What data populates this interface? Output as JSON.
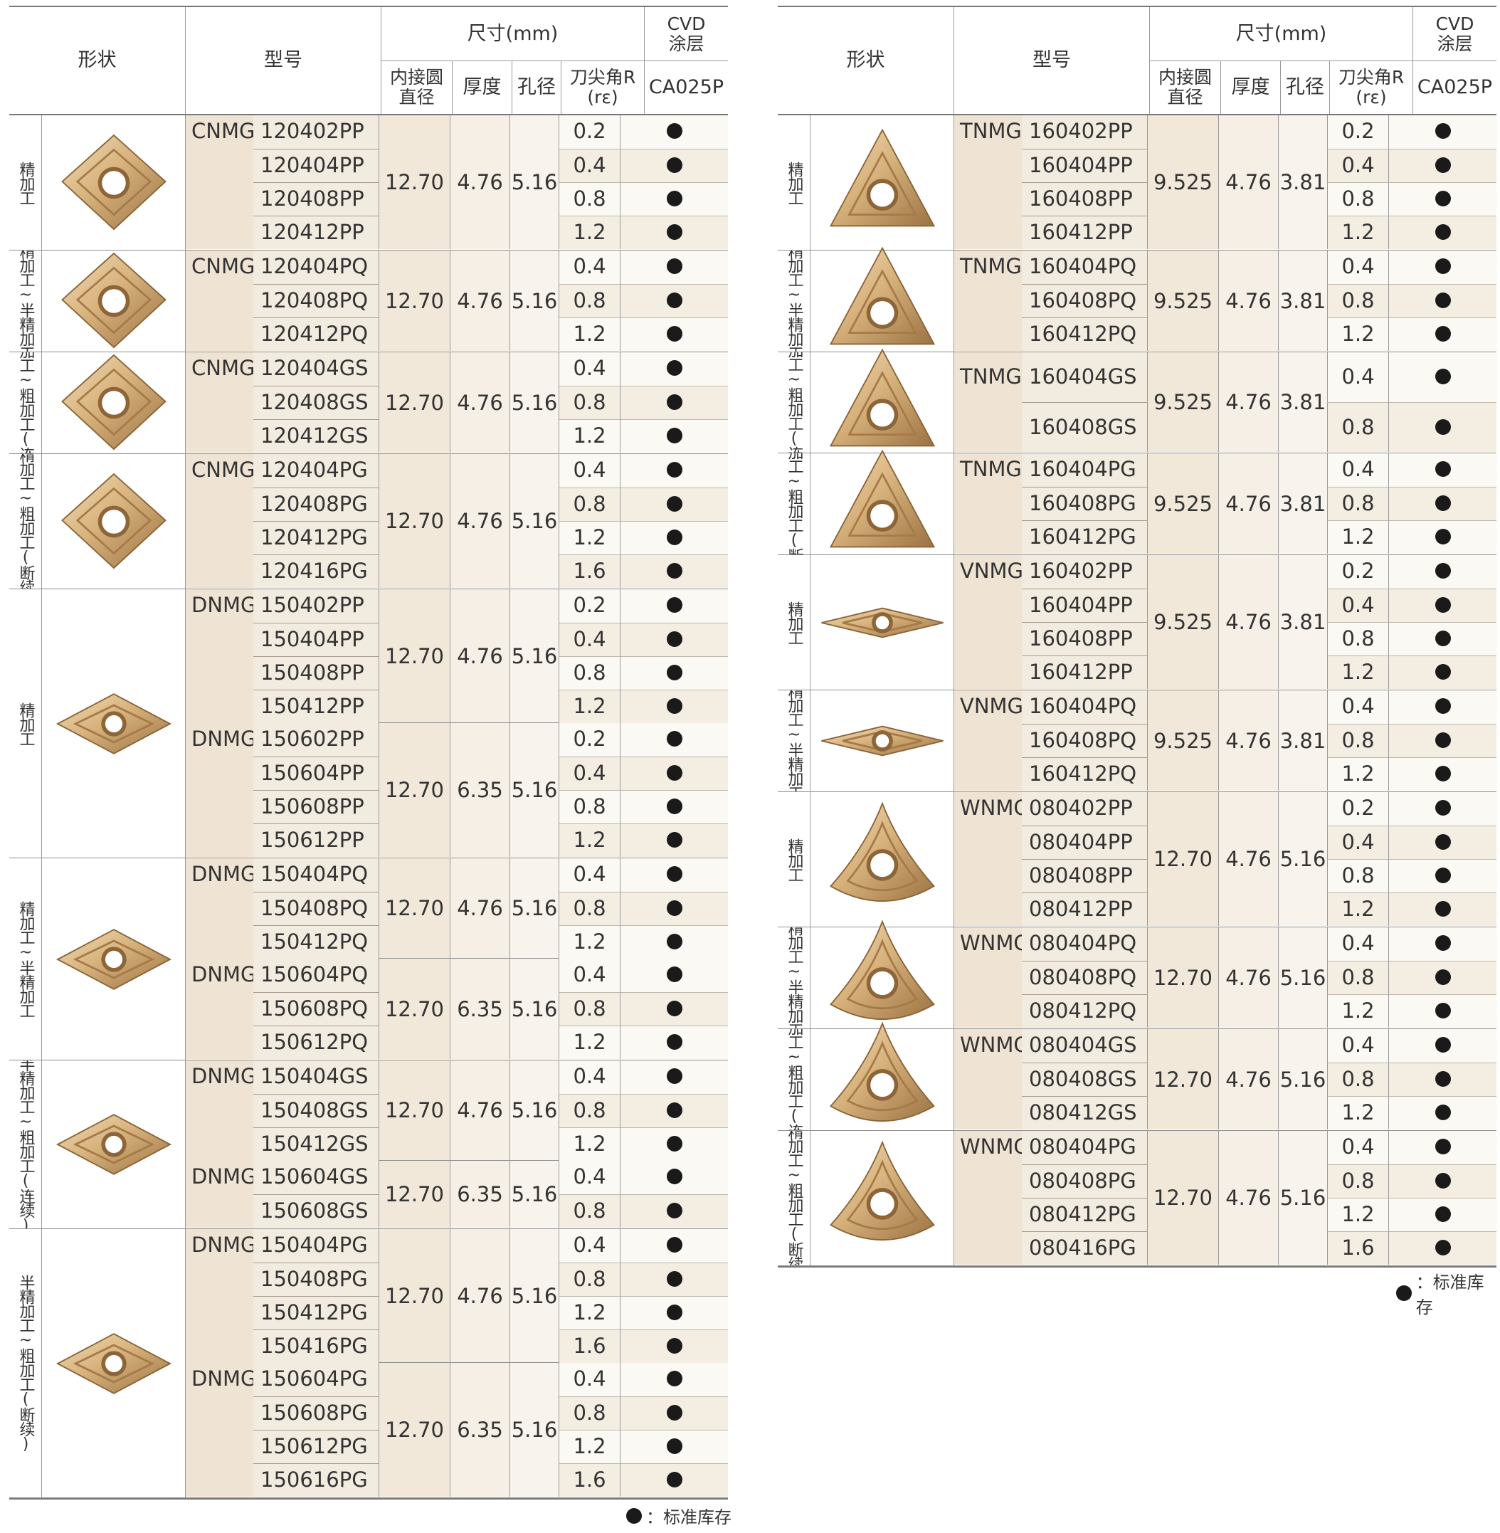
{
  "header": {
    "shape": "形状",
    "model": "型号",
    "dims": "尺寸(mm)",
    "cvd": "CVD\n涂层",
    "ic": "内接圆\n直径",
    "thick": "厚度",
    "hole": "孔径",
    "radius": "刀尖角R\n(rε)",
    "grade": "CA025P"
  },
  "legend": {
    "label": "：标准库存"
  },
  "left_groups": [
    {
      "label": "精加工",
      "shape": "C",
      "series": [
        {
          "prefix": "CNMG",
          "ic": "12.70",
          "t": "4.76",
          "h": "5.16",
          "rows": [
            {
              "code": "120402PP",
              "r": "0.2"
            },
            {
              "code": "120404PP",
              "r": "0.4"
            },
            {
              "code": "120408PP",
              "r": "0.8"
            },
            {
              "code": "120412PP",
              "r": "1.2"
            }
          ]
        }
      ]
    },
    {
      "label": "精加工~半精加工",
      "shape": "C",
      "series": [
        {
          "prefix": "CNMG",
          "ic": "12.70",
          "t": "4.76",
          "h": "5.16",
          "rows": [
            {
              "code": "120404PQ",
              "r": "0.4"
            },
            {
              "code": "120408PQ",
              "r": "0.8"
            },
            {
              "code": "120412PQ",
              "r": "1.2"
            }
          ]
        }
      ]
    },
    {
      "label": "半精加工~粗加工(连续)",
      "shape": "C",
      "series": [
        {
          "prefix": "CNMG",
          "ic": "12.70",
          "t": "4.76",
          "h": "5.16",
          "rows": [
            {
              "code": "120404GS",
              "r": "0.4"
            },
            {
              "code": "120408GS",
              "r": "0.8"
            },
            {
              "code": "120412GS",
              "r": "1.2"
            }
          ]
        }
      ]
    },
    {
      "label": "半精加工~粗加工(断续)",
      "shape": "C",
      "series": [
        {
          "prefix": "CNMG",
          "ic": "12.70",
          "t": "4.76",
          "h": "5.16",
          "rows": [
            {
              "code": "120404PG",
              "r": "0.4"
            },
            {
              "code": "120408PG",
              "r": "0.8"
            },
            {
              "code": "120412PG",
              "r": "1.2"
            },
            {
              "code": "120416PG",
              "r": "1.6"
            }
          ]
        }
      ]
    },
    {
      "label": "精加工",
      "shape": "D",
      "series": [
        {
          "prefix": "DNMG",
          "ic": "12.70",
          "t": "4.76",
          "h": "5.16",
          "rows": [
            {
              "code": "150402PP",
              "r": "0.2"
            },
            {
              "code": "150404PP",
              "r": "0.4"
            },
            {
              "code": "150408PP",
              "r": "0.8"
            },
            {
              "code": "150412PP",
              "r": "1.2"
            }
          ]
        },
        {
          "prefix": "DNMG",
          "ic": "12.70",
          "t": "6.35",
          "h": "5.16",
          "rows": [
            {
              "code": "150602PP",
              "r": "0.2"
            },
            {
              "code": "150604PP",
              "r": "0.4"
            },
            {
              "code": "150608PP",
              "r": "0.8"
            },
            {
              "code": "150612PP",
              "r": "1.2"
            }
          ]
        }
      ]
    },
    {
      "label": "精加工~半精加工",
      "shape": "D",
      "series": [
        {
          "prefix": "DNMG",
          "ic": "12.70",
          "t": "4.76",
          "h": "5.16",
          "rows": [
            {
              "code": "150404PQ",
              "r": "0.4"
            },
            {
              "code": "150408PQ",
              "r": "0.8"
            },
            {
              "code": "150412PQ",
              "r": "1.2"
            }
          ]
        },
        {
          "prefix": "DNMG",
          "ic": "12.70",
          "t": "6.35",
          "h": "5.16",
          "rows": [
            {
              "code": "150604PQ",
              "r": "0.4"
            },
            {
              "code": "150608PQ",
              "r": "0.8"
            },
            {
              "code": "150612PQ",
              "r": "1.2"
            }
          ]
        }
      ]
    },
    {
      "label": "半精加工~粗加工(连续)",
      "shape": "D",
      "series": [
        {
          "prefix": "DNMG",
          "ic": "12.70",
          "t": "4.76",
          "h": "5.16",
          "rows": [
            {
              "code": "150404GS",
              "r": "0.4"
            },
            {
              "code": "150408GS",
              "r": "0.8"
            },
            {
              "code": "150412GS",
              "r": "1.2"
            }
          ]
        },
        {
          "prefix": "DNMG",
          "ic": "12.70",
          "t": "6.35",
          "h": "5.16",
          "rows": [
            {
              "code": "150604GS",
              "r": "0.4"
            },
            {
              "code": "150608GS",
              "r": "0.8"
            }
          ]
        }
      ]
    },
    {
      "label": "半精加工~粗加工(断续)",
      "shape": "D",
      "series": [
        {
          "prefix": "DNMG",
          "ic": "12.70",
          "t": "4.76",
          "h": "5.16",
          "rows": [
            {
              "code": "150404PG",
              "r": "0.4"
            },
            {
              "code": "150408PG",
              "r": "0.8"
            },
            {
              "code": "150412PG",
              "r": "1.2"
            },
            {
              "code": "150416PG",
              "r": "1.6"
            }
          ]
        },
        {
          "prefix": "DNMG",
          "ic": "12.70",
          "t": "6.35",
          "h": "5.16",
          "rows": [
            {
              "code": "150604PG",
              "r": "0.4"
            },
            {
              "code": "150608PG",
              "r": "0.8"
            },
            {
              "code": "150612PG",
              "r": "1.2"
            },
            {
              "code": "150616PG",
              "r": "1.6"
            }
          ]
        }
      ]
    }
  ],
  "right_groups": [
    {
      "label": "精加工",
      "shape": "T",
      "series": [
        {
          "prefix": "TNMG",
          "ic": "9.525",
          "t": "4.76",
          "h": "3.81",
          "rows": [
            {
              "code": "160402PP",
              "r": "0.2"
            },
            {
              "code": "160404PP",
              "r": "0.4"
            },
            {
              "code": "160408PP",
              "r": "0.8"
            },
            {
              "code": "160412PP",
              "r": "1.2"
            }
          ]
        }
      ]
    },
    {
      "label": "精加工~半精加工",
      "shape": "T",
      "series": [
        {
          "prefix": "TNMG",
          "ic": "9.525",
          "t": "4.76",
          "h": "3.81",
          "rows": [
            {
              "code": "160404PQ",
              "r": "0.4"
            },
            {
              "code": "160408PQ",
              "r": "0.8"
            },
            {
              "code": "160412PQ",
              "r": "1.2"
            }
          ]
        }
      ]
    },
    {
      "label": "半精加工~粗加工(连续)",
      "shape": "T",
      "series": [
        {
          "prefix": "TNMG",
          "ic": "9.525",
          "t": "4.76",
          "h": "3.81",
          "tall": true,
          "rows": [
            {
              "code": "160404GS",
              "r": "0.4"
            },
            {
              "code": "160408GS",
              "r": "0.8"
            }
          ]
        }
      ]
    },
    {
      "label": "半精加工~粗加工(断续)",
      "shape": "T",
      "series": [
        {
          "prefix": "TNMG",
          "ic": "9.525",
          "t": "4.76",
          "h": "3.81",
          "rows": [
            {
              "code": "160404PG",
              "r": "0.4"
            },
            {
              "code": "160408PG",
              "r": "0.8"
            },
            {
              "code": "160412PG",
              "r": "1.2"
            }
          ]
        }
      ]
    },
    {
      "label": "精加工",
      "shape": "V",
      "series": [
        {
          "prefix": "VNMG",
          "ic": "9.525",
          "t": "4.76",
          "h": "3.81",
          "rows": [
            {
              "code": "160402PP",
              "r": "0.2"
            },
            {
              "code": "160404PP",
              "r": "0.4"
            },
            {
              "code": "160408PP",
              "r": "0.8"
            },
            {
              "code": "160412PP",
              "r": "1.2"
            }
          ]
        }
      ]
    },
    {
      "label": "精加工~半精加工",
      "shape": "V",
      "series": [
        {
          "prefix": "VNMG",
          "ic": "9.525",
          "t": "4.76",
          "h": "3.81",
          "rows": [
            {
              "code": "160404PQ",
              "r": "0.4"
            },
            {
              "code": "160408PQ",
              "r": "0.8"
            },
            {
              "code": "160412PQ",
              "r": "1.2"
            }
          ]
        }
      ]
    },
    {
      "label": "精加工",
      "shape": "W",
      "series": [
        {
          "prefix": "WNMG",
          "ic": "12.70",
          "t": "4.76",
          "h": "5.16",
          "rows": [
            {
              "code": "080402PP",
              "r": "0.2"
            },
            {
              "code": "080404PP",
              "r": "0.4"
            },
            {
              "code": "080408PP",
              "r": "0.8"
            },
            {
              "code": "080412PP",
              "r": "1.2"
            }
          ]
        }
      ]
    },
    {
      "label": "精加工~半精加工",
      "shape": "W",
      "series": [
        {
          "prefix": "WNMG",
          "ic": "12.70",
          "t": "4.76",
          "h": "5.16",
          "rows": [
            {
              "code": "080404PQ",
              "r": "0.4"
            },
            {
              "code": "080408PQ",
              "r": "0.8"
            },
            {
              "code": "080412PQ",
              "r": "1.2"
            }
          ]
        }
      ]
    },
    {
      "label": "半精加工~粗加工(连续)",
      "shape": "W",
      "series": [
        {
          "prefix": "WNMG",
          "ic": "12.70",
          "t": "4.76",
          "h": "5.16",
          "rows": [
            {
              "code": "080404GS",
              "r": "0.4"
            },
            {
              "code": "080408GS",
              "r": "0.8"
            },
            {
              "code": "080412GS",
              "r": "1.2"
            }
          ]
        }
      ]
    },
    {
      "label": "半精加工~粗加工(断续)",
      "shape": "W",
      "series": [
        {
          "prefix": "WNMG",
          "ic": "12.70",
          "t": "4.76",
          "h": "5.16",
          "rows": [
            {
              "code": "080404PG",
              "r": "0.4"
            },
            {
              "code": "080408PG",
              "r": "0.8"
            },
            {
              "code": "080412PG",
              "r": "1.2"
            },
            {
              "code": "080416PG",
              "r": "1.6"
            }
          ]
        }
      ]
    }
  ]
}
